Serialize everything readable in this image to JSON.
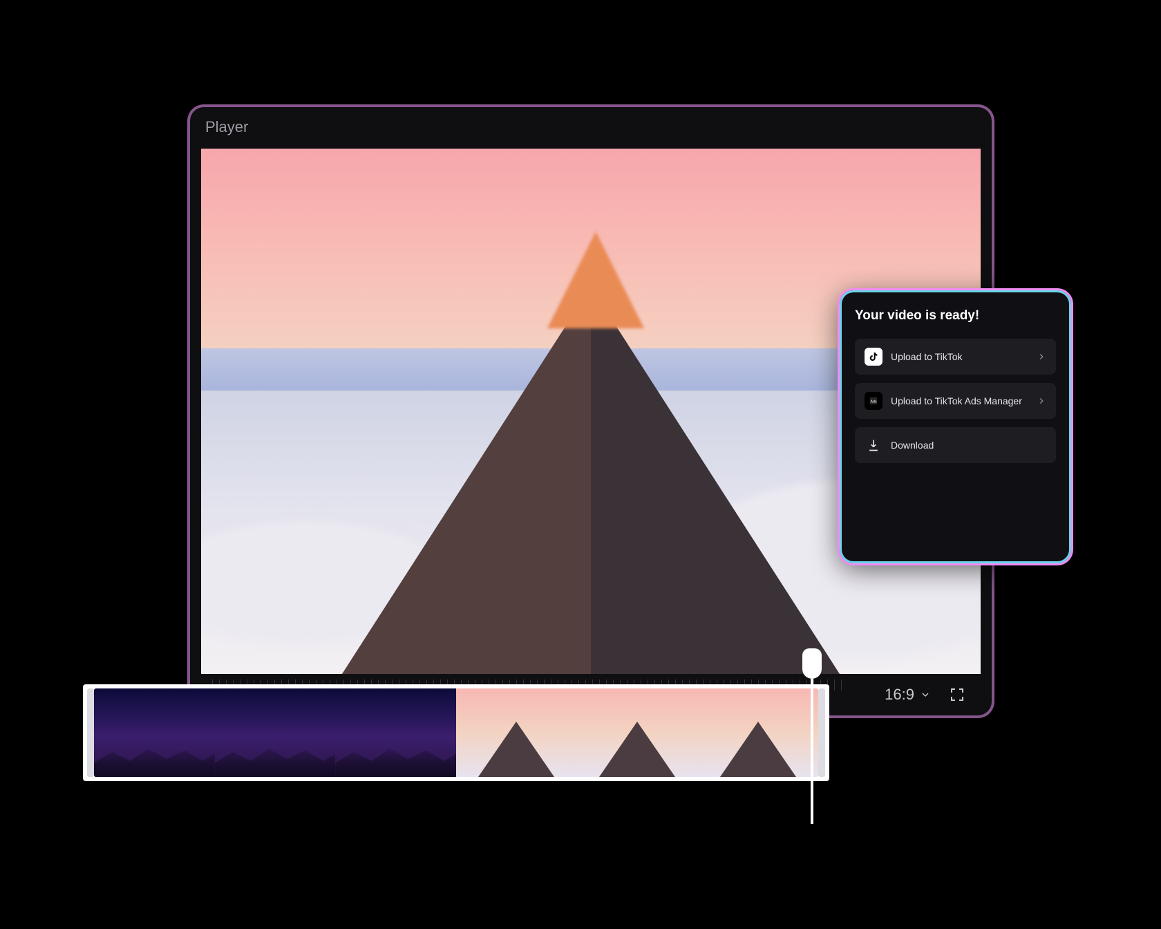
{
  "player": {
    "title": "Player",
    "aspect_ratio": "16:9"
  },
  "export": {
    "title": "Your video is ready!",
    "options": [
      {
        "label": "Upload to TikTok",
        "icon": "tiktok",
        "has_chevron": true
      },
      {
        "label": "Upload to TikTok Ads Manager",
        "icon": "ads",
        "has_chevron": true
      },
      {
        "label": "Download",
        "icon": "download",
        "has_chevron": false
      }
    ]
  },
  "timeline": {
    "clips": [
      {
        "kind": "night"
      },
      {
        "kind": "night"
      },
      {
        "kind": "night"
      },
      {
        "kind": "day"
      },
      {
        "kind": "day"
      },
      {
        "kind": "day"
      }
    ]
  }
}
